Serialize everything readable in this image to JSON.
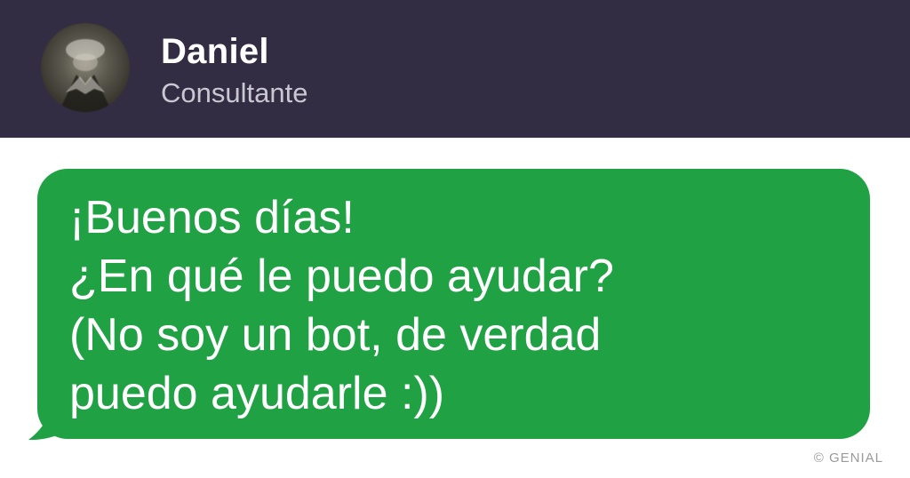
{
  "header": {
    "name": "Daniel",
    "status": "Consultante"
  },
  "message": {
    "lines": [
      "¡Buenos días!",
      "¿En qué le puedo ayudar?",
      "(No soy un bot, de verdad",
      "puedo ayudarle :))"
    ]
  },
  "watermark": "© GENIAL",
  "colors": {
    "header_bg": "#322d43",
    "bubble_bg": "#1fa144",
    "text_on_dark": "#ffffff"
  }
}
